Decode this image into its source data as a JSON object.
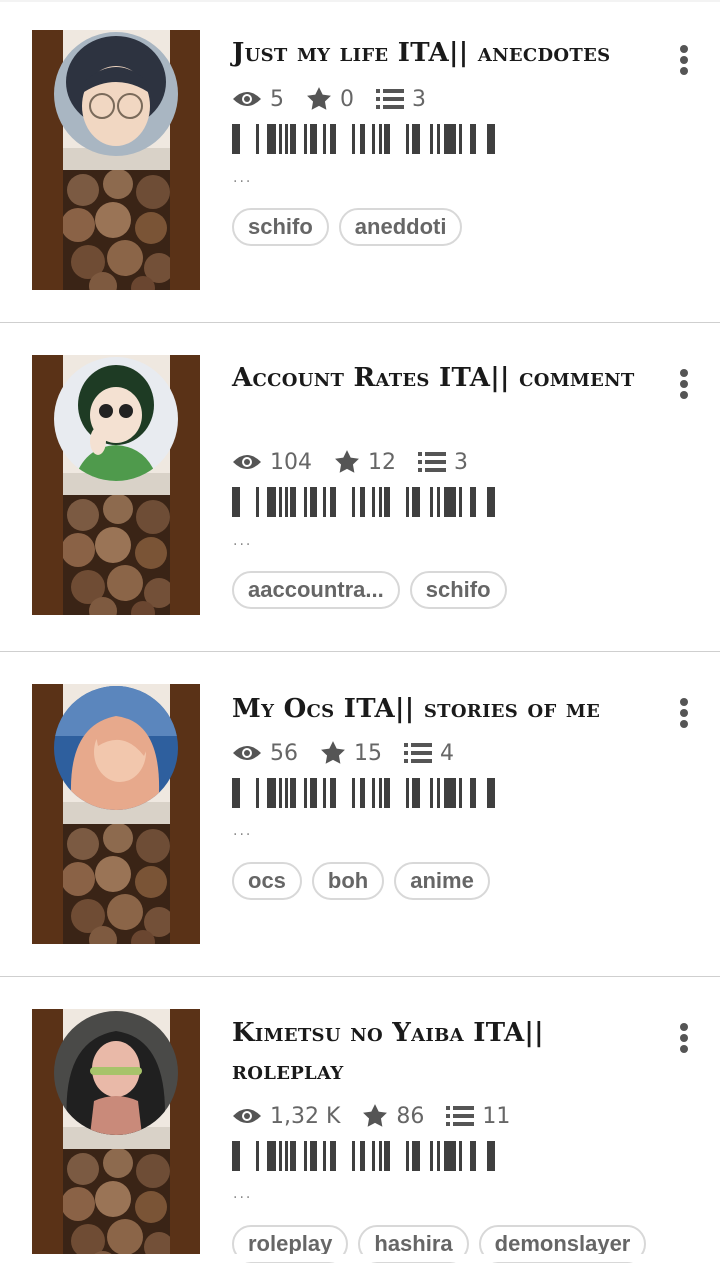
{
  "stories": [
    {
      "title": "Just my life ITA|| anecdotes",
      "views": "5",
      "votes": "0",
      "parts": "3",
      "excerpt": "...",
      "tags": [
        "schifo",
        "aneddoti"
      ],
      "avatar_palette": [
        "#a9b6c2",
        "#2d3340",
        "#f1d7c2"
      ]
    },
    {
      "title": "Account Rates ITA|| comment",
      "views": "104",
      "votes": "12",
      "parts": "3",
      "excerpt": "...",
      "tags": [
        "aaccountra...",
        "schifo"
      ],
      "avatar_palette": [
        "#e8ebf0",
        "#1e3b24",
        "#4f9a4c"
      ]
    },
    {
      "title": " My Ocs ITA|| stories of me",
      "views": "56",
      "votes": "15",
      "parts": "4",
      "excerpt": "...",
      "tags": [
        "ocs",
        "boh",
        "anime"
      ],
      "avatar_palette": [
        "#2e5f9e",
        "#f2c7ad",
        "#e7a98c"
      ]
    },
    {
      "title": "Kimetsu no Yaiba ITA|| roleplay",
      "views": "1,32 K",
      "votes": "86",
      "parts": "11",
      "excerpt": "...",
      "tags": [
        "roleplay",
        "hashira",
        "demonslayer"
      ],
      "avatar_palette": [
        "#4a4a48",
        "#202020",
        "#e9b9a8"
      ]
    }
  ],
  "colors": {
    "cover_frame": "#5a3217",
    "text": "#1a1a1a",
    "stat_text": "#666666",
    "divider": "#cfcfcf"
  }
}
